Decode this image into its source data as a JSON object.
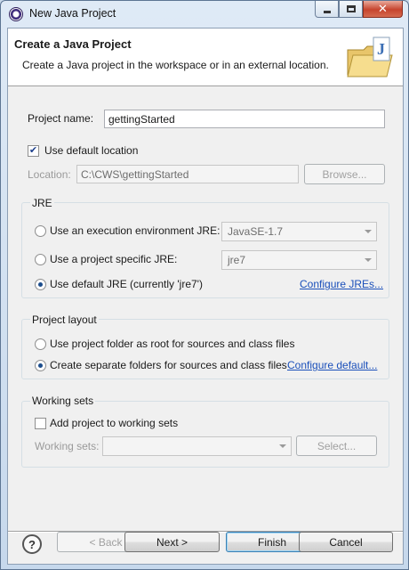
{
  "window": {
    "title": "New Java Project"
  },
  "banner": {
    "title": "Create a Java Project",
    "description": "Create a Java project in the workspace or in an external location.",
    "icon": "java-project-folder-icon"
  },
  "project_name": {
    "label": "Project name:",
    "value": "gettingStarted"
  },
  "default_location": {
    "label": "Use default location",
    "checked": true
  },
  "location": {
    "label": "Location:",
    "value": "C:\\CWS\\gettingStarted",
    "browse_label": "Browse..."
  },
  "jre": {
    "group_title": "JRE",
    "options": [
      {
        "label": "Use an execution environment JRE:",
        "combo_value": "JavaSE-1.7",
        "selected": false
      },
      {
        "label": "Use a project specific JRE:",
        "combo_value": "jre7",
        "selected": false
      },
      {
        "label": "Use default JRE (currently 'jre7')",
        "selected": true
      }
    ],
    "configure_link": "Configure JREs..."
  },
  "project_layout": {
    "group_title": "Project layout",
    "options": [
      {
        "label": "Use project folder as root for sources and class files",
        "selected": false
      },
      {
        "label": "Create separate folders for sources and class files",
        "selected": true
      }
    ],
    "configure_link": "Configure default..."
  },
  "working_sets": {
    "group_title": "Working sets",
    "add_label": "Add project to working sets",
    "add_checked": false,
    "sets_label": "Working sets:",
    "sets_value": "",
    "select_label": "Select..."
  },
  "footer": {
    "help": "?",
    "back": "< Back",
    "next": "Next >",
    "finish": "Finish",
    "cancel": "Cancel"
  },
  "colors": {
    "link": "#1a4fba",
    "close_button": "#c6442d",
    "default_button_border": "#3c7fb1"
  }
}
